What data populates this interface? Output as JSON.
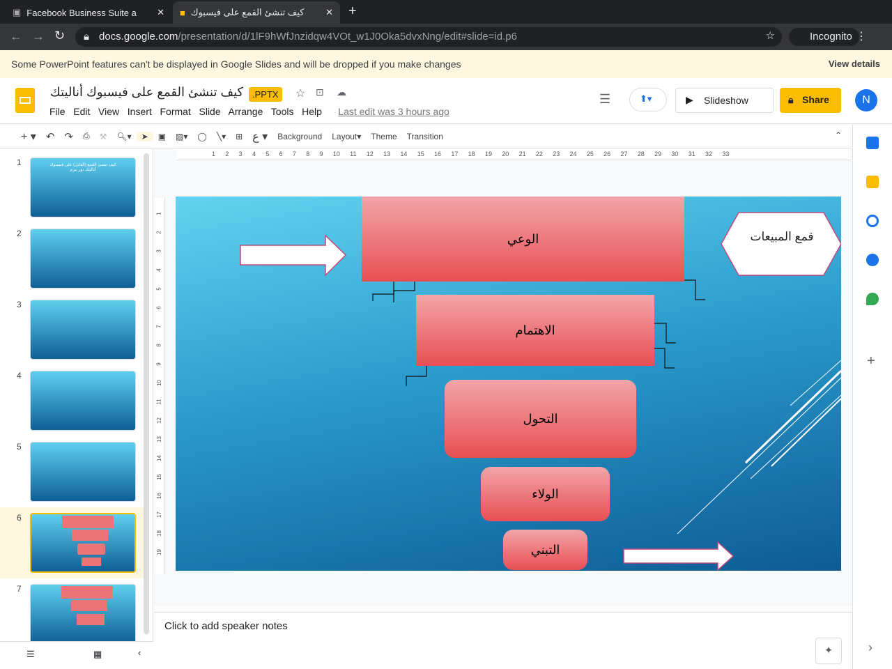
{
  "browser": {
    "tabs": [
      {
        "title": "Facebook Business Suite a"
      },
      {
        "title": "كيف تنشئ القمع على فيسبوك"
      }
    ],
    "url_domain": "docs.google.com",
    "url_path": "/presentation/d/1lF9hWfJnzidqw4VOt_w1J0Oka5dvxNng/edit#slide=id.p6",
    "profile": "Incognito"
  },
  "banner": {
    "message": "Some PowerPoint features can't be displayed in Google Slides and will be dropped if you make changes",
    "action": "View details"
  },
  "doc": {
    "title": "كيف تنشئ القمع على فيسبوك أناليتك",
    "badge": ".PPTX",
    "last_edit": "Last edit was 3 hours ago",
    "slideshow": "Slideshow",
    "share": "Share",
    "avatar": "N"
  },
  "menu": [
    "File",
    "Edit",
    "View",
    "Insert",
    "Format",
    "Slide",
    "Arrange",
    "Tools",
    "Help"
  ],
  "toolbar": {
    "background": "Background",
    "layout": "Layout",
    "theme": "Theme",
    "transition": "Transition",
    "input_tool": "ع"
  },
  "ruler": [
    "1",
    "2",
    "3",
    "4",
    "5",
    "6",
    "7",
    "8",
    "9",
    "10",
    "11",
    "12",
    "13",
    "14",
    "15",
    "16",
    "17",
    "18",
    "19",
    "20",
    "21",
    "22",
    "23",
    "24",
    "25",
    "26",
    "27",
    "28",
    "29",
    "30",
    "31",
    "32",
    "33"
  ],
  "vruler": [
    "1",
    "2",
    "3",
    "4",
    "5",
    "6",
    "7",
    "8",
    "9",
    "10",
    "11",
    "12",
    "13",
    "14",
    "15",
    "16",
    "17",
    "18",
    "19"
  ],
  "slides": [
    {
      "num": "1",
      "text": "كيف تنشئ القمع (القابل) على فيسبوك أناليتك نور بيرم"
    },
    {
      "num": "2"
    },
    {
      "num": "3"
    },
    {
      "num": "4"
    },
    {
      "num": "5"
    },
    {
      "num": "6"
    },
    {
      "num": "7"
    }
  ],
  "slide": {
    "awareness": "الوعي",
    "interest": "الاهتمام",
    "conversion": "التحول",
    "loyalty": "الولاء",
    "adoption": "التبني",
    "hexagon": "قمع المبيعات"
  },
  "notes": {
    "placeholder": "Click to add speaker notes"
  },
  "colors": {
    "accent": "#fbbc04",
    "share_bg": "#fbbc04",
    "shape_top": "#f2a5a8",
    "shape_bottom": "#e84f53"
  }
}
